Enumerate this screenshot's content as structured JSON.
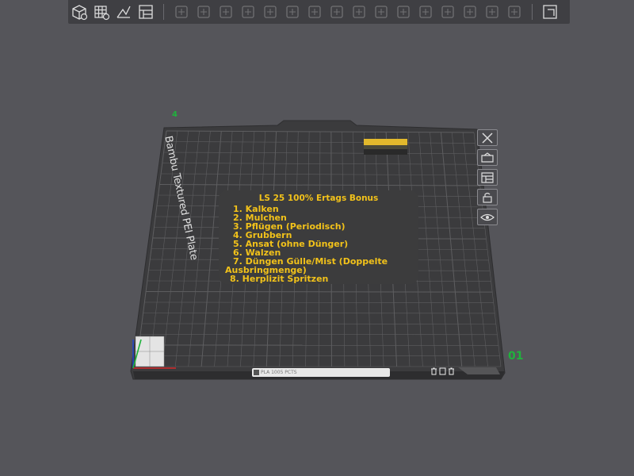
{
  "toolbar": {
    "tools": [
      {
        "icon": "add-cube-icon"
      },
      {
        "icon": "grid-plate-icon"
      },
      {
        "icon": "auto-orient-icon"
      },
      {
        "icon": "arrange-layout-icon"
      }
    ],
    "dim_tools": [
      {
        "icon": "copy-icon"
      },
      {
        "icon": "paste-icon"
      },
      {
        "icon": "list-icon"
      },
      {
        "icon": "move-icon"
      },
      {
        "icon": "rotate-icon"
      },
      {
        "icon": "scale-icon"
      },
      {
        "icon": "lay-on-face-icon"
      },
      {
        "icon": "cut-icon"
      },
      {
        "icon": "split-icon"
      },
      {
        "icon": "boolean-icon"
      },
      {
        "icon": "support-paint-icon"
      },
      {
        "icon": "seam-paint-icon"
      },
      {
        "icon": "color-paint-icon"
      },
      {
        "icon": "measure-icon"
      },
      {
        "icon": "text-icon"
      },
      {
        "icon": "assembly-icon"
      }
    ],
    "end_tool": {
      "icon": "view-toggle-icon"
    }
  },
  "plate": {
    "label": "Bambu Textured PEI Plate",
    "number": "01",
    "corner_mark": "4",
    "bottom_bar_text": "PLA 1005 PCTS"
  },
  "note": {
    "title": "LS 25 100% Ertags Bonus",
    "items": [
      "1. Kalken",
      "2. Mulchen",
      "3. Pflügen (Periodisch)",
      "4. Grubbern",
      "5. Ansat (ohne Dünger)",
      "6. Walzen",
      "7. Düngen Gülle/Mist (Doppelte",
      "Ausbringmenge)",
      "8. Herplizit Spritzen"
    ]
  },
  "side_tools": [
    {
      "icon": "close-icon"
    },
    {
      "icon": "plate-settings-icon"
    },
    {
      "icon": "arrange-icon"
    },
    {
      "icon": "lock-icon"
    },
    {
      "icon": "eye-icon"
    }
  ],
  "colors": {
    "background": "#55555a",
    "plate": "#3b3b3d",
    "grid": "#5a5a5c",
    "note_text": "#f2c21a",
    "accent_green": "#1fb33c",
    "model_yellow": "#e2b92c"
  }
}
